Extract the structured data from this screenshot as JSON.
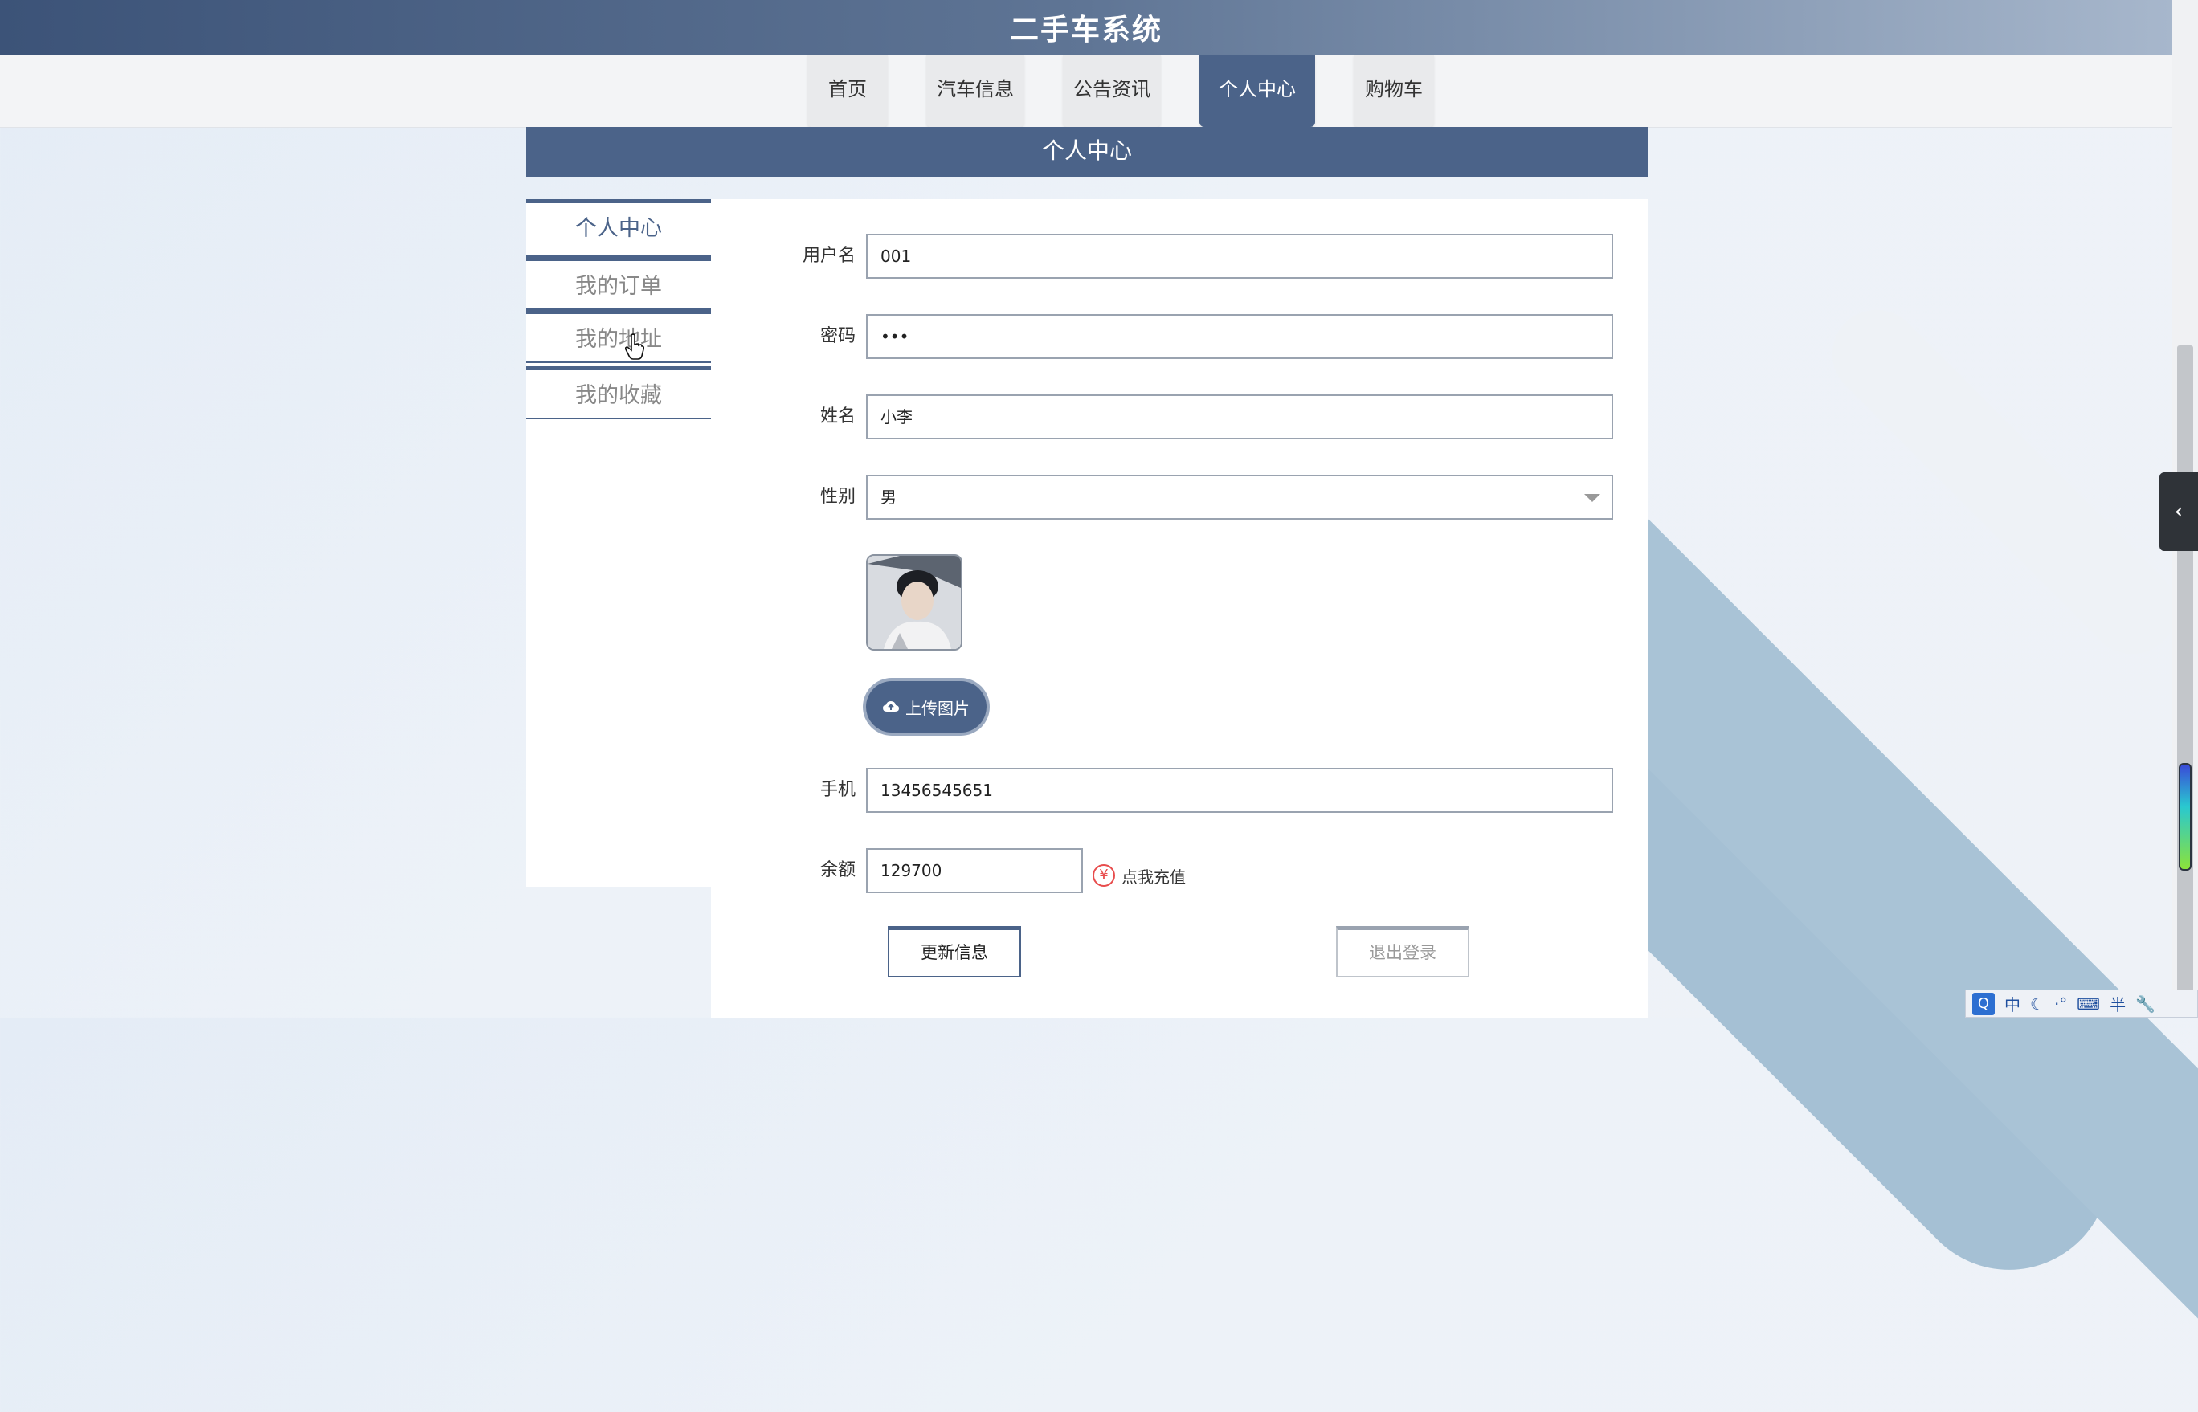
{
  "app": {
    "title": "二手车系统"
  },
  "nav": {
    "items": [
      {
        "label": "首页",
        "active": false
      },
      {
        "label": "汽车信息",
        "active": false
      },
      {
        "label": "公告资讯",
        "active": false
      },
      {
        "label": "个人中心",
        "active": true
      },
      {
        "label": "购物车",
        "active": false
      }
    ]
  },
  "section": {
    "title": "个人中心"
  },
  "sidebar": {
    "items": [
      {
        "label": "个人中心",
        "active": true
      },
      {
        "label": "我的订单",
        "active": false
      },
      {
        "label": "我的地址",
        "active": false
      },
      {
        "label": "我的收藏",
        "active": false
      }
    ]
  },
  "form": {
    "username": {
      "label": "用户名",
      "value": "001"
    },
    "password": {
      "label": "密码",
      "value": "•••"
    },
    "name": {
      "label": "姓名",
      "value": "小李"
    },
    "gender": {
      "label": "性别",
      "value": "男"
    },
    "upload_label": "上传图片",
    "phone": {
      "label": "手机",
      "value": "13456545651"
    },
    "balance": {
      "label": "余额",
      "value": "129700"
    },
    "recharge_label": "点我充值",
    "recharge_symbol": "¥",
    "update_label": "更新信息",
    "logout_label": "退出登录"
  },
  "tray": {
    "items": [
      "中",
      "·°",
      "⌨",
      "半",
      "🔧"
    ]
  },
  "colors": {
    "primary": "#4b6389",
    "topbar_start": "#3c5378",
    "topbar_end": "#a7b7cc",
    "deco": "#a9c3d6",
    "danger": "#e84d4d"
  }
}
